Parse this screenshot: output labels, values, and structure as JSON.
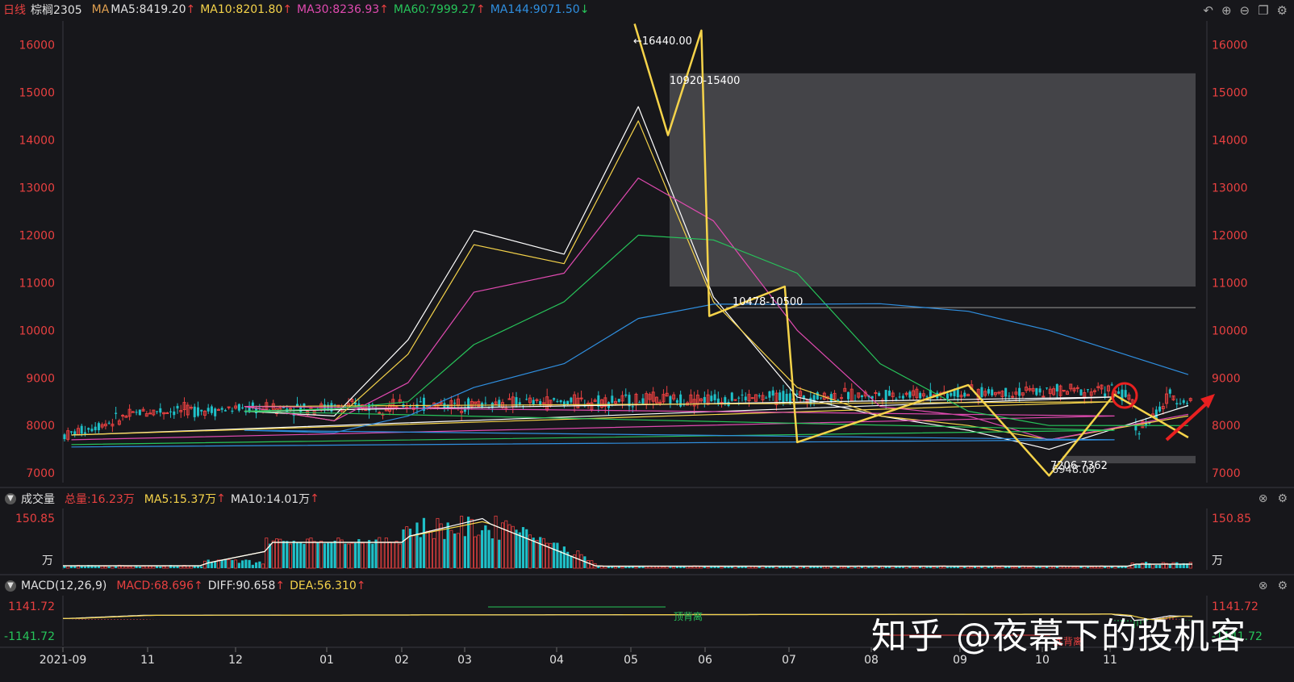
{
  "header": {
    "period_label": "日线",
    "symbol": "棕榈2305",
    "ma_title": "MA",
    "ma5": "MA5:8419.20",
    "ma10": "MA10:8201.80",
    "ma30": "MA30:8236.93",
    "ma60": "MA60:7999.27",
    "ma144": "MA144:9071.50",
    "arrow_up": "↑",
    "arrow_down": "↓"
  },
  "toolbar_icons": [
    "undo-icon",
    "zoom-in-icon",
    "zoom-out-icon",
    "window-icon",
    "settings-icon"
  ],
  "volume_panel": {
    "title": "成交量",
    "total": "总量:16.23万",
    "ma5": "MA5:15.37万",
    "ma10": "MA10:14.01万",
    "max_label": "150.85",
    "unit": "万"
  },
  "macd_panel": {
    "title": "MACD(12,26,9)",
    "macd": "MACD:68.696",
    "diff": "DIFF:90.658",
    "dea": "DEA:56.310",
    "max_label": "1141.72",
    "min_label": "-1141.72",
    "annotation_top": "顶背离",
    "annotation_bottom": "底背离"
  },
  "watermark": "知乎 @夜幕下的投机客",
  "colors": {
    "background": "#17171b",
    "up": "#e84040",
    "down": "#1fc0c8",
    "ma5": "#ffffff",
    "ma10": "#f5d34a",
    "ma30": "#e04ab0",
    "ma60": "#27c45a",
    "ma144": "#2f8fe0",
    "zigzag": "#f5d34a",
    "zone": "#47474b"
  },
  "chart_data": {
    "type": "candlestick",
    "x_ticks": [
      "2021-09",
      "11",
      "12",
      "01",
      "02",
      "03",
      "04",
      "05",
      "06",
      "07",
      "08",
      "09",
      "10",
      "11"
    ],
    "y_ticks": [
      7000,
      8000,
      9000,
      10000,
      11000,
      12000,
      13000,
      14000,
      15000,
      16000
    ],
    "ylim": [
      6800,
      16500
    ],
    "annotations": [
      {
        "text": "←16440.00",
        "x": "05",
        "y": 16440
      },
      {
        "text": "10920-15400",
        "x": "05",
        "y": 15400
      },
      {
        "text": "10478-10500",
        "x": "06",
        "y": 10500
      },
      {
        "text": "7206-7362",
        "x": "10",
        "y": 7362
      },
      {
        "text": "6948.00",
        "x": "10",
        "y": 6948
      }
    ],
    "zones": [
      {
        "x_start": "05",
        "x_end": "11",
        "y_low": 10920,
        "y_high": 15400
      },
      {
        "x_start": "10",
        "x_end": "11",
        "y_low": 7206,
        "y_high": 7362
      }
    ],
    "price_path": [
      [
        "2021-09",
        7800
      ],
      [
        "2021-09",
        8300
      ],
      [
        "11",
        8750
      ],
      [
        "11",
        8500
      ],
      [
        "12",
        8300
      ],
      [
        "12",
        8600
      ],
      [
        "12",
        8000
      ],
      [
        "01",
        7700
      ],
      [
        "01",
        8400
      ],
      [
        "01",
        8800
      ],
      [
        "02",
        9700
      ],
      [
        "02",
        10400
      ],
      [
        "03",
        12000
      ],
      [
        "03",
        12400
      ],
      [
        "03",
        11000
      ],
      [
        "04",
        11200
      ],
      [
        "04",
        11800
      ],
      [
        "04",
        12700
      ],
      [
        "05",
        13800
      ],
      [
        "05",
        16440
      ],
      [
        "05",
        14100
      ],
      [
        "05",
        16300
      ],
      [
        "06",
        10300
      ],
      [
        "06",
        10700
      ],
      [
        "06",
        10900
      ],
      [
        "07",
        10000
      ],
      [
        "07",
        8800
      ],
      [
        "07",
        7700
      ],
      [
        "08",
        8100
      ],
      [
        "08",
        8600
      ],
      [
        "09",
        8500
      ],
      [
        "09",
        7800
      ],
      [
        "10",
        7000
      ],
      [
        "10",
        7600
      ],
      [
        "11",
        8100
      ],
      [
        "11",
        8600
      ],
      [
        "11",
        8500
      ]
    ],
    "ma_lines": [
      {
        "name": "MA5",
        "path": [
          [
            "2021-09",
            7800
          ],
          [
            "11",
            8600
          ],
          [
            "12",
            8300
          ],
          [
            "01",
            8200
          ],
          [
            "02",
            9800
          ],
          [
            "03",
            12100
          ],
          [
            "04",
            11600
          ],
          [
            "05",
            14700
          ],
          [
            "06",
            10700
          ],
          [
            "07",
            8600
          ],
          [
            "08",
            8200
          ],
          [
            "09",
            7900
          ],
          [
            "10",
            7500
          ],
          [
            "11",
            8419
          ]
        ]
      },
      {
        "name": "MA10",
        "path": [
          [
            "2021-09",
            7800
          ],
          [
            "11",
            8500
          ],
          [
            "12",
            8400
          ],
          [
            "01",
            8100
          ],
          [
            "02",
            9500
          ],
          [
            "03",
            11800
          ],
          [
            "04",
            11400
          ],
          [
            "05",
            14400
          ],
          [
            "06",
            10600
          ],
          [
            "07",
            8800
          ],
          [
            "08",
            8200
          ],
          [
            "09",
            8000
          ],
          [
            "10",
            7700
          ],
          [
            "11",
            8201
          ]
        ]
      },
      {
        "name": "MA30",
        "path": [
          [
            "2021-09",
            7700
          ],
          [
            "11",
            8200
          ],
          [
            "12",
            8400
          ],
          [
            "01",
            8100
          ],
          [
            "02",
            8900
          ],
          [
            "03",
            10800
          ],
          [
            "04",
            11200
          ],
          [
            "05",
            13200
          ],
          [
            "06",
            12300
          ],
          [
            "07",
            10000
          ],
          [
            "08",
            8400
          ],
          [
            "09",
            8200
          ],
          [
            "10",
            7700
          ],
          [
            "11",
            8236
          ]
        ]
      },
      {
        "name": "MA60",
        "path": [
          [
            "2021-09",
            7600
          ],
          [
            "11",
            7900
          ],
          [
            "12",
            8300
          ],
          [
            "01",
            8350
          ],
          [
            "02",
            8500
          ],
          [
            "03",
            9700
          ],
          [
            "04",
            10600
          ],
          [
            "05",
            12000
          ],
          [
            "06",
            11900
          ],
          [
            "07",
            11200
          ],
          [
            "08",
            9300
          ],
          [
            "09",
            8300
          ],
          [
            "10",
            8000
          ],
          [
            "11",
            7999
          ]
        ]
      },
      {
        "name": "MA144",
        "path": [
          [
            "2021-09",
            7550
          ],
          [
            "11",
            7700
          ],
          [
            "12",
            7900
          ],
          [
            "01",
            7850
          ],
          [
            "02",
            8200
          ],
          [
            "03",
            8800
          ],
          [
            "04",
            9300
          ],
          [
            "05",
            10250
          ],
          [
            "06",
            10550
          ],
          [
            "07",
            10550
          ],
          [
            "08",
            10560
          ],
          [
            "09",
            10400
          ],
          [
            "10",
            10000
          ],
          [
            "11",
            9071
          ]
        ]
      }
    ],
    "zigzag": [
      [
        "05",
        16440
      ],
      [
        "05",
        14100
      ],
      [
        "05",
        16300
      ],
      [
        "06",
        10300
      ],
      [
        "06",
        10920
      ],
      [
        "07",
        7650
      ],
      [
        "09",
        8850
      ],
      [
        "10",
        6948
      ],
      [
        "11",
        8650
      ],
      [
        "11",
        7750
      ]
    ]
  }
}
